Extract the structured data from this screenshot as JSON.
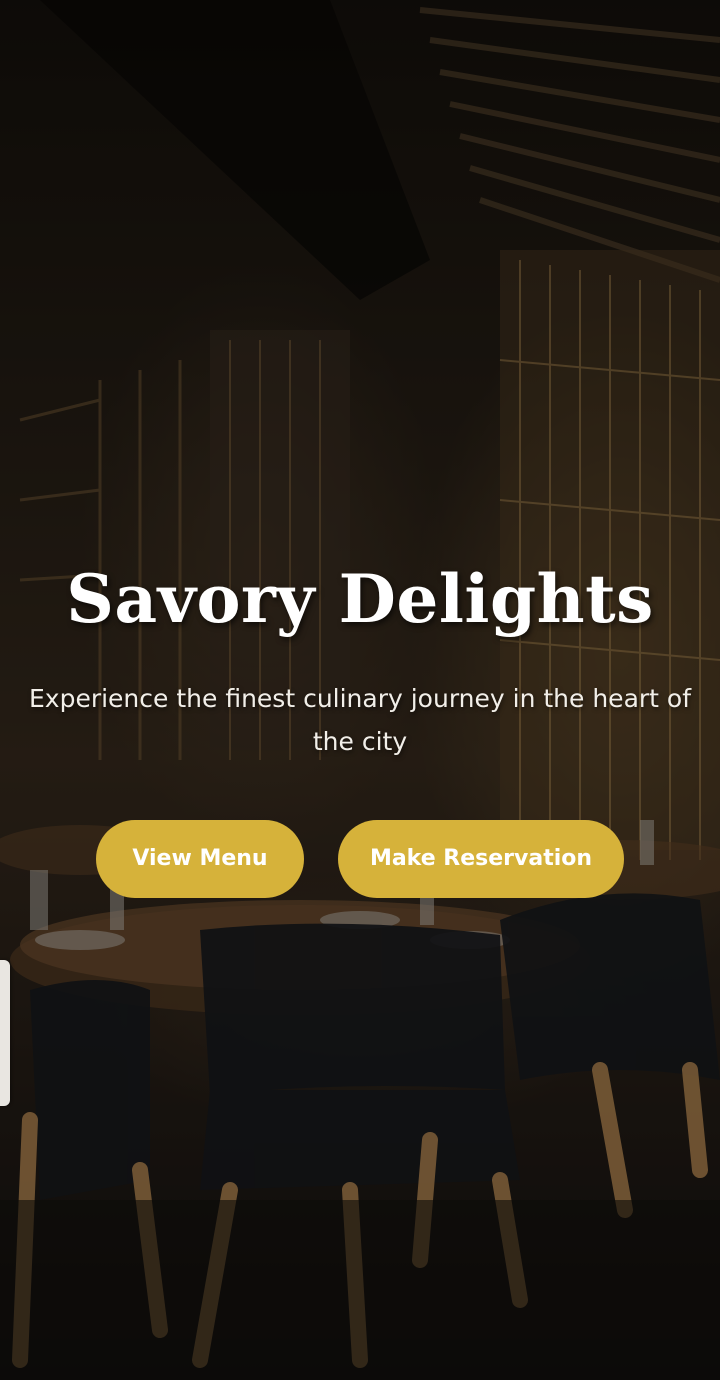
{
  "hero": {
    "title": "Savory Delights",
    "subtitle": "Experience the finest culinary journey in the heart of the city",
    "background_description_icon": "restaurant-interior-photo"
  },
  "actions": {
    "view_menu_label": "View Menu",
    "reservation_label": "Make Reservation"
  },
  "colors": {
    "accent": "#d6b23a",
    "text": "#ffffff"
  }
}
